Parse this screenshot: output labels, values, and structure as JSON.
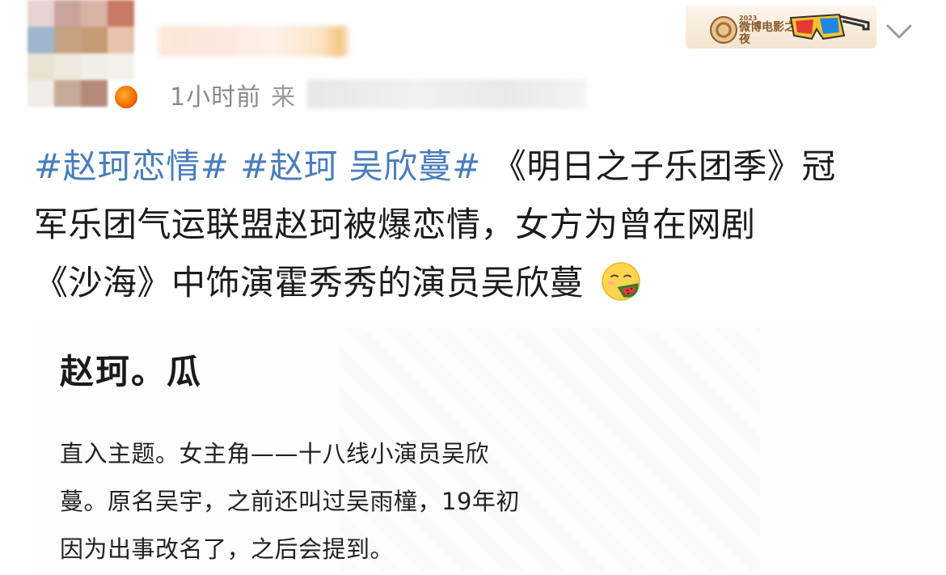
{
  "header": {
    "time": "1小时前",
    "source_prefix": "来",
    "decoration_text": "微博电影之夜",
    "decoration_year": "2023",
    "avatar_colors": [
      "#e7d3d1",
      "#c9a39e",
      "#d9b3a6",
      "#c97a63",
      "#9fb6cf",
      "#c7a283",
      "#c69c74",
      "#e8c2ad",
      "#e8e3d3",
      "#eee9dd",
      "#f1eee6",
      "#f4f1ea",
      "#f0ece6",
      "#c7ab98",
      "#b7897b",
      "#ffffff"
    ]
  },
  "post": {
    "hashtag1": "#赵珂恋情#",
    "hashtag2": "#赵珂 吴欣蔓#",
    "line1_text": " 《明日之子乐团季》冠",
    "line2": "军乐团气运联盟赵珂被爆恋情，女方为曾在网剧",
    "line3": "《沙海》中饰演霍秀秀的演员吴欣蔓",
    "emoji_name": "eating-watermelon-emoji"
  },
  "image_content": {
    "title": "赵珂。瓜",
    "body_lines": [
      "直入主题。女主角——十八线小演员吴欣",
      "蔓。原名吴宇，之前还叫过吴雨橦，19年初",
      "因为出事改名了，之后会提到。"
    ]
  },
  "icons": {
    "chevron": "chevron-down-icon",
    "badge": "vip-badge-icon"
  },
  "colors": {
    "hashtag": "#4a7dbb",
    "time": "#8a8a8a",
    "text": "#1c1c1c"
  }
}
